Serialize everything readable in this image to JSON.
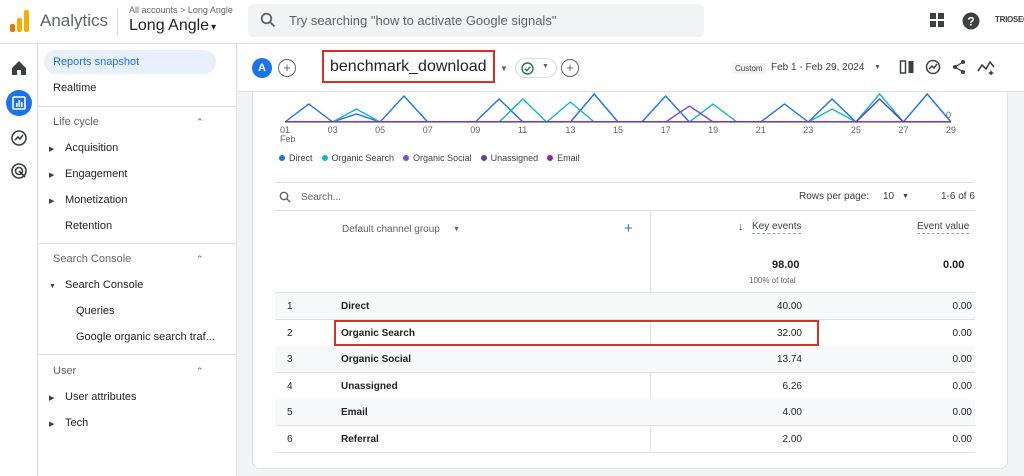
{
  "app": {
    "name": "Analytics",
    "breadcrumb_1": "All accounts",
    "breadcrumb_sep": ">",
    "breadcrumb_2": "Long Angle",
    "property": "Long Angle",
    "search_placeholder": "Try searching \"how to activate Google signals\"",
    "brand_badge": "TRIOSEQ"
  },
  "nav": {
    "top_items": [
      "Reports snapshot",
      "Realtime"
    ],
    "life_cycle": {
      "title": "Life cycle",
      "items": [
        "Acquisition",
        "Engagement",
        "Monetization",
        "Retention"
      ]
    },
    "search_console": {
      "title": "Search Console",
      "group": "Search Console",
      "items": [
        "Queries",
        "Google organic search traf..."
      ]
    },
    "user": {
      "title": "User",
      "items": [
        "User attributes",
        "Tech"
      ]
    }
  },
  "report": {
    "avatar_letter": "A",
    "title": "benchmark_download",
    "custom_label": "Custom",
    "date_range": "Feb 1 - Feb 29, 2024"
  },
  "chart_data": {
    "type": "line",
    "x_ticks": [
      "01",
      "03",
      "05",
      "07",
      "09",
      "11",
      "13",
      "15",
      "17",
      "19",
      "21",
      "23",
      "25",
      "27",
      "29"
    ],
    "x_sub_label": "Feb",
    "y_right_tick": "0",
    "series": [
      {
        "name": "Direct",
        "color": "#1a73e8"
      },
      {
        "name": "Organic Search",
        "color": "#12b5cb"
      },
      {
        "name": "Organic Social",
        "color": "#7b4fd6"
      },
      {
        "name": "Unassigned",
        "color": "#5b3fb0"
      },
      {
        "name": "Email",
        "color": "#8e24aa"
      }
    ]
  },
  "table": {
    "search_placeholder": "Search...",
    "rows_per_page_label": "Rows per page:",
    "rows_per_page_value": "10",
    "range_label": "1-6 of 6",
    "dimension_header": "Default channel group",
    "metric_headers": [
      "Key events",
      "Event value"
    ],
    "totals": {
      "key_events": "98.00",
      "key_events_sub": "100% of total",
      "event_value": "0.00"
    },
    "rows": [
      {
        "idx": "1",
        "name": "Direct",
        "key_events": "40.00",
        "event_value": "0.00"
      },
      {
        "idx": "2",
        "name": "Organic Search",
        "key_events": "32.00",
        "event_value": "0.00"
      },
      {
        "idx": "3",
        "name": "Organic Social",
        "key_events": "13.74",
        "event_value": "0.00"
      },
      {
        "idx": "4",
        "name": "Unassigned",
        "key_events": "6.26",
        "event_value": "0.00"
      },
      {
        "idx": "5",
        "name": "Email",
        "key_events": "4.00",
        "event_value": "0.00"
      },
      {
        "idx": "6",
        "name": "Referral",
        "key_events": "2.00",
        "event_value": "0.00"
      }
    ]
  }
}
